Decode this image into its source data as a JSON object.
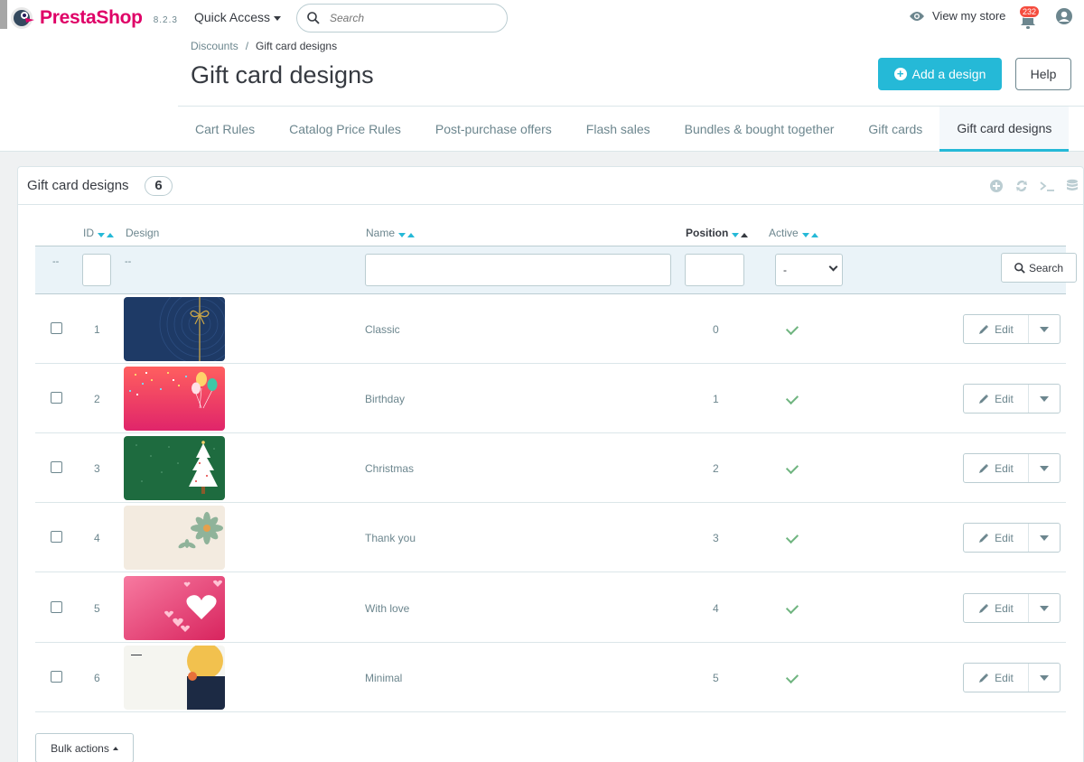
{
  "header": {
    "brand": "PrestaShop",
    "version": "8.2.3",
    "quick_access": "Quick Access",
    "search_placeholder": "Search",
    "view_store": "View my store",
    "notifications_count": "232"
  },
  "breadcrumb": {
    "parent": "Discounts",
    "separator": "/",
    "current": "Gift card designs"
  },
  "page": {
    "title": "Gift card designs",
    "add_button": "Add a design",
    "help_button": "Help"
  },
  "tabs": [
    {
      "label": "Cart Rules",
      "active": false
    },
    {
      "label": "Catalog Price Rules",
      "active": false
    },
    {
      "label": "Post-purchase offers",
      "active": false
    },
    {
      "label": "Flash sales",
      "active": false
    },
    {
      "label": "Bundles & bought together",
      "active": false
    },
    {
      "label": "Gift cards",
      "active": false
    },
    {
      "label": "Gift card designs",
      "active": true
    }
  ],
  "panel": {
    "title": "Gift card designs",
    "count": "6",
    "toolbar_icons": [
      "add-icon",
      "refresh-icon",
      "sql-query-icon",
      "database-export-icon"
    ]
  },
  "table": {
    "columns": {
      "id": "ID",
      "design": "Design",
      "name": "Name",
      "position": "Position",
      "active": "Active"
    },
    "filters": {
      "bulk_dash": "--",
      "design_dash": "--",
      "active_select": "-",
      "search_button": "Search"
    },
    "rows": [
      {
        "id": "1",
        "design": "classic",
        "name": "Classic",
        "position": "0",
        "active": true,
        "edit": "Edit"
      },
      {
        "id": "2",
        "design": "birthday",
        "name": "Birthday",
        "position": "1",
        "active": true,
        "edit": "Edit"
      },
      {
        "id": "3",
        "design": "christmas",
        "name": "Christmas",
        "position": "2",
        "active": true,
        "edit": "Edit"
      },
      {
        "id": "4",
        "design": "thank-you",
        "name": "Thank you",
        "position": "3",
        "active": true,
        "edit": "Edit"
      },
      {
        "id": "5",
        "design": "with-love",
        "name": "With love",
        "position": "4",
        "active": true,
        "edit": "Edit"
      },
      {
        "id": "6",
        "design": "minimal",
        "name": "Minimal",
        "position": "5",
        "active": true,
        "edit": "Edit"
      }
    ]
  },
  "bulk_actions": "Bulk actions",
  "colors": {
    "accent": "#25b9d7",
    "brand": "#df0067",
    "active_check": "#70b580",
    "text": "#363a41",
    "muted": "#6c868e"
  }
}
